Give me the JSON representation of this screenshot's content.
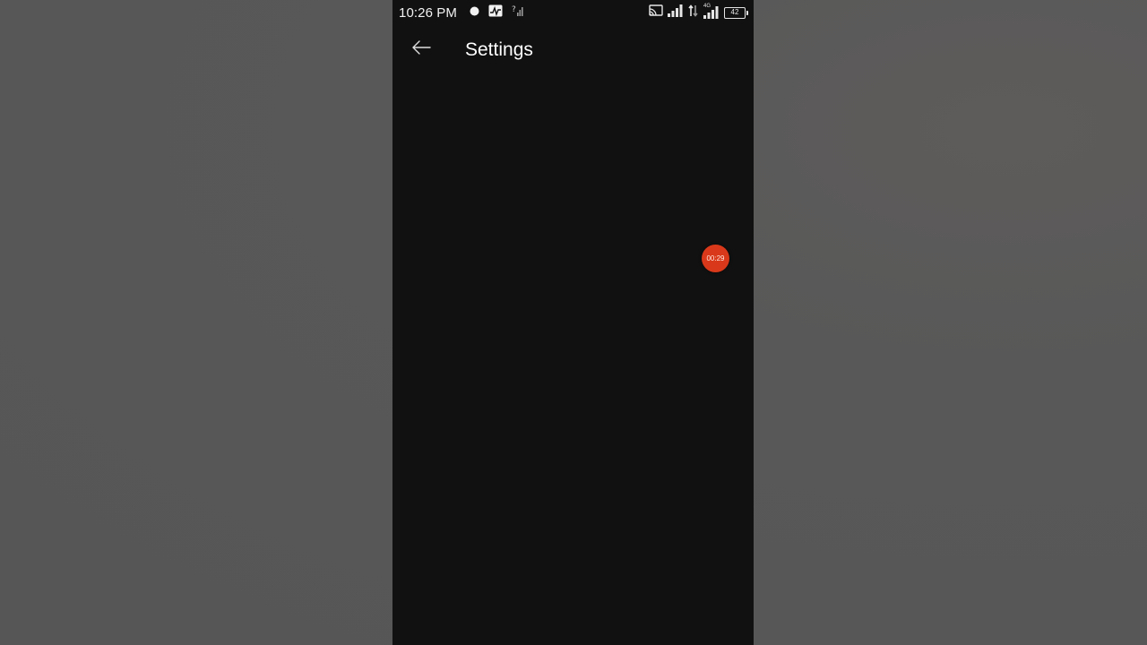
{
  "status_bar": {
    "time": "10:26 PM",
    "battery_level": "42",
    "network_type": "4G",
    "icons": {
      "left": [
        "recording-dot-icon",
        "activity-monitor-icon",
        "no-sim-signal-icon"
      ],
      "right": [
        "screen-cast-icon",
        "signal-bars-icon",
        "data-arrows-icon",
        "signal-bars-4g-icon",
        "battery-icon"
      ]
    }
  },
  "app_bar": {
    "title": "Settings",
    "back_icon": "arrow-left-icon"
  },
  "recorder": {
    "elapsed": "00:29",
    "color": "#d9391a"
  },
  "colors": {
    "screen_background": "#111111",
    "outside_background": "#575757",
    "text_primary": "#ffffff"
  }
}
